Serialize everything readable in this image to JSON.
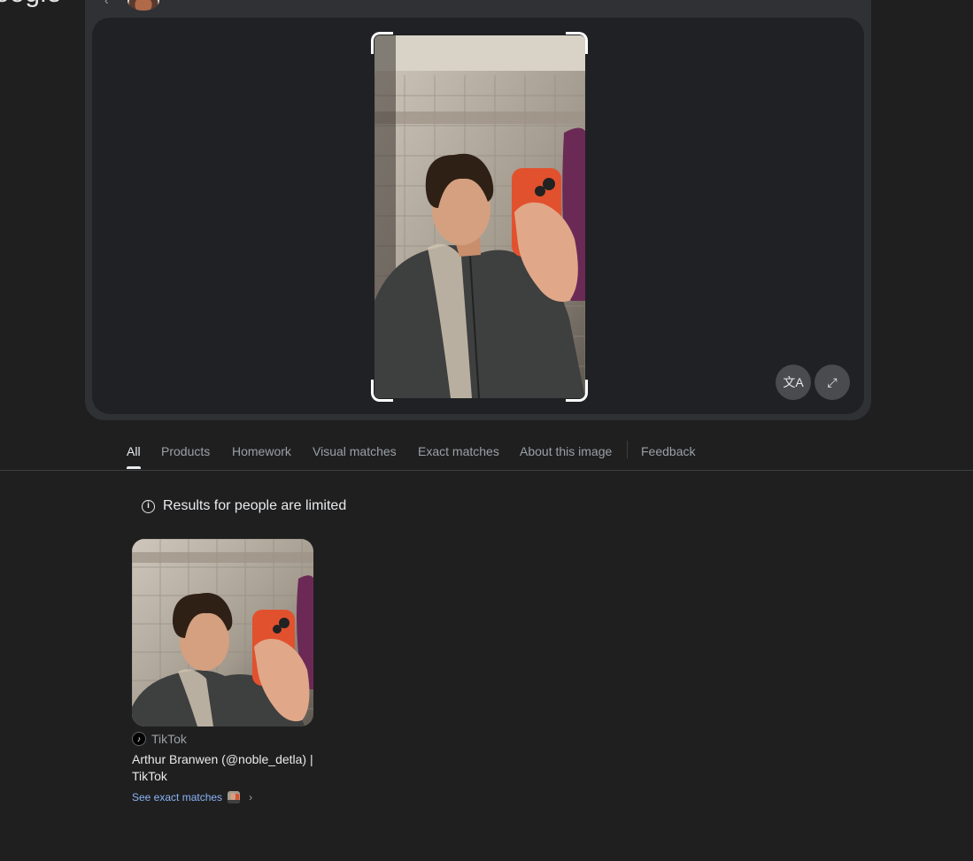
{
  "header": {
    "logo_text": "oogle"
  },
  "preview": {
    "translate_button_label": "文A",
    "fullscreen_button_label": "⤢"
  },
  "tabs": [
    {
      "label": "All"
    },
    {
      "label": "Products"
    },
    {
      "label": "Homework"
    },
    {
      "label": "Visual matches"
    },
    {
      "label": "Exact matches"
    },
    {
      "label": "About this image"
    },
    {
      "label": "Feedback"
    }
  ],
  "notice": {
    "icon": "i",
    "text": "Results for people are limited"
  },
  "result": {
    "source_icon": "♪",
    "source": "TikTok",
    "title": "Arthur Branwen (@noble_detla) | TikTok",
    "link": "See exact matches",
    "chevron": "›"
  },
  "colors": {
    "background": "#1f1f1f",
    "panel": "#303134",
    "link": "#8ab4f8"
  }
}
